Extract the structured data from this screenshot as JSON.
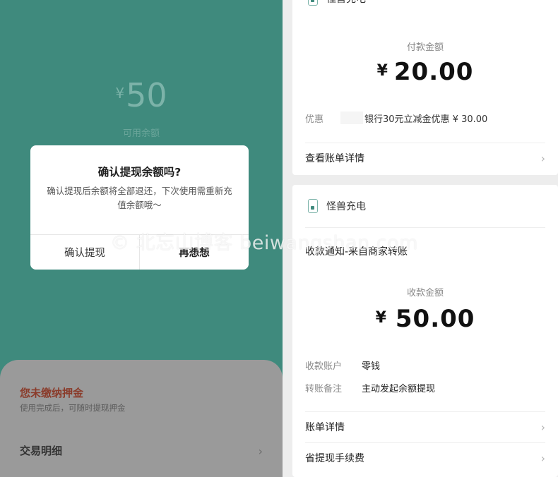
{
  "left": {
    "balance": {
      "currency": "¥",
      "amount": "50",
      "label": "可用余额"
    },
    "dialog": {
      "title": "确认提现余额吗?",
      "body": "确认提现后余额将全部退还，下次使用需重新充值余额哦～",
      "confirm": "确认提现",
      "cancel": "再想想"
    },
    "deposit": {
      "title": "您未缴纳押金",
      "subtitle": "使用完成后，可随时提现押金"
    },
    "transactions": {
      "label": "交易明细"
    }
  },
  "payment_card": {
    "merchant": "怪兽充电",
    "amount_label": "付款金额",
    "currency": "¥",
    "amount": "20.00",
    "discount_label": "优惠",
    "discount_text": "银行30元立减金优惠 ¥ 30.00",
    "details_link": "查看账单详情"
  },
  "receipt_card": {
    "merchant": "怪兽充电",
    "notice": "收款通知-来自商家转账",
    "amount_label": "收款金额",
    "currency": "¥",
    "amount": "50.00",
    "account_label": "收款账户",
    "account_value": "零钱",
    "remark_label": "转账备注",
    "remark_value": "主动发起余额提现",
    "details_link": "账单详情",
    "fee_link": "省提现手续费"
  },
  "watermark": "© 北忘山博客 beiwangshan.com"
}
